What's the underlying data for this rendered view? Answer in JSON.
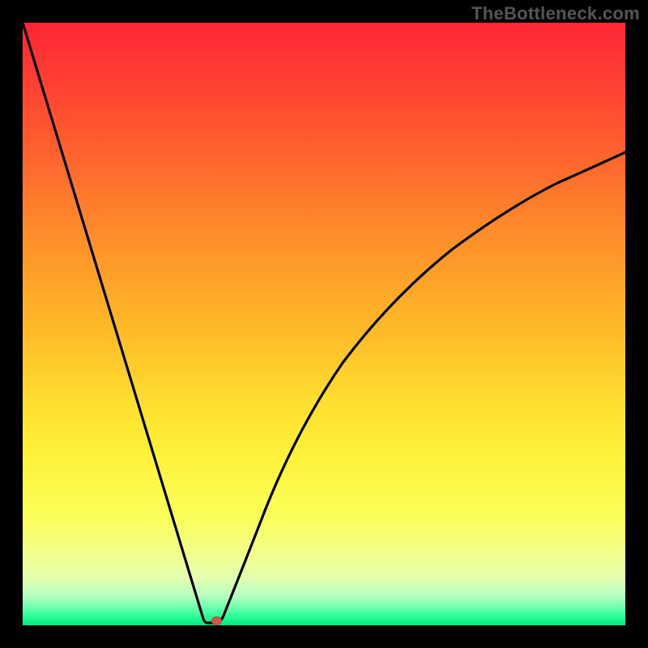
{
  "watermark": "TheBottleneck.com",
  "colors": {
    "frame": "#000000",
    "curve": "#000000",
    "marker": "#cc5a48",
    "gradient_top": "#ff2436",
    "gradient_bottom": "#00e77d"
  },
  "chart_data": {
    "type": "line",
    "title": "",
    "xlabel": "",
    "ylabel": "",
    "xlim": [
      0,
      100
    ],
    "ylim": [
      0,
      100
    ],
    "grid": false,
    "legend": false,
    "series": [
      {
        "name": "left-branch",
        "x": [
          0,
          5,
          10,
          15,
          20,
          25,
          27,
          29,
          30,
          31
        ],
        "values": [
          100,
          84,
          68,
          51,
          35,
          18,
          11,
          4,
          1,
          0
        ]
      },
      {
        "name": "right-branch",
        "x": [
          31,
          33,
          35,
          40,
          45,
          50,
          55,
          60,
          65,
          70,
          75,
          80,
          85,
          90,
          95,
          100
        ],
        "values": [
          0,
          5,
          11,
          24,
          35,
          43,
          50,
          56,
          61,
          65,
          68,
          71,
          74,
          76,
          78,
          79
        ]
      }
    ],
    "annotations": [
      {
        "name": "minimum-marker",
        "x": 31,
        "y": 0
      }
    ]
  }
}
